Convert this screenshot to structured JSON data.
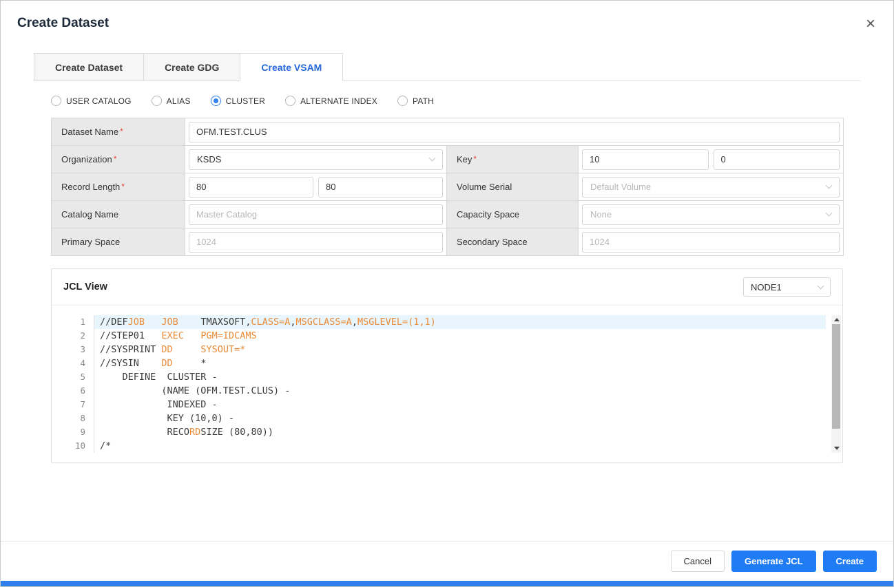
{
  "modal": {
    "title": "Create Dataset",
    "close_glyph": "×"
  },
  "colors": {
    "accent": "#2f80ed",
    "keyword": "#e98b39",
    "required": "#e5493a",
    "active_line": "#e9f5fc"
  },
  "tabs": [
    {
      "label": "Create Dataset",
      "active": false
    },
    {
      "label": "Create GDG",
      "active": false
    },
    {
      "label": "Create VSAM",
      "active": true
    }
  ],
  "radio_group": [
    {
      "label": "USER CATALOG",
      "selected": false
    },
    {
      "label": "ALIAS",
      "selected": false
    },
    {
      "label": "CLUSTER",
      "selected": true
    },
    {
      "label": "ALTERNATE INDEX",
      "selected": false
    },
    {
      "label": "PATH",
      "selected": false
    }
  ],
  "form": {
    "required_mark": "*",
    "dataset_name": {
      "label": "Dataset Name",
      "required": true,
      "value": "OFM.TEST.CLUS"
    },
    "organization": {
      "label": "Organization",
      "required": true,
      "value": "KSDS"
    },
    "key": {
      "label": "Key",
      "required": true,
      "value1": "10",
      "value2": "0"
    },
    "record_length": {
      "label": "Record Length",
      "required": true,
      "value1": "80",
      "value2": "80"
    },
    "volume_serial": {
      "label": "Volume Serial",
      "placeholder": "Default Volume"
    },
    "catalog_name": {
      "label": "Catalog Name",
      "placeholder": "Master Catalog"
    },
    "capacity_space": {
      "label": "Capacity Space",
      "placeholder": "None"
    },
    "primary_space": {
      "label": "Primary Space",
      "placeholder": "1024"
    },
    "secondary_space": {
      "label": "Secondary Space",
      "placeholder": "1024"
    }
  },
  "jcl_view": {
    "title": "JCL View",
    "node_select_value": "NODE1",
    "lines": [
      {
        "no": "1",
        "active": true,
        "segments": [
          {
            "t": "//DEF"
          },
          {
            "t": "JOB",
            "c": "k"
          },
          {
            "t": "   "
          },
          {
            "t": "JOB",
            "c": "k"
          },
          {
            "t": "    "
          },
          {
            "t": "TMAXSOFT,"
          },
          {
            "t": "CLASS=A",
            "c": "k"
          },
          {
            "t": ","
          },
          {
            "t": "MSGCLASS=A",
            "c": "k"
          },
          {
            "t": ","
          },
          {
            "t": "MSGLEVEL=(1,1)",
            "c": "k"
          }
        ]
      },
      {
        "no": "2",
        "active": false,
        "segments": [
          {
            "t": "//STEP01"
          },
          {
            "t": "   "
          },
          {
            "t": "EXEC",
            "c": "k"
          },
          {
            "t": "   "
          },
          {
            "t": "PGM=IDCAMS",
            "c": "k"
          }
        ]
      },
      {
        "no": "3",
        "active": false,
        "segments": [
          {
            "t": "//SYSPRINT"
          },
          {
            "t": " "
          },
          {
            "t": "DD",
            "c": "k"
          },
          {
            "t": "     "
          },
          {
            "t": "SYSOUT=*",
            "c": "k"
          }
        ]
      },
      {
        "no": "4",
        "active": false,
        "segments": [
          {
            "t": "//SYSIN"
          },
          {
            "t": "    "
          },
          {
            "t": "DD",
            "c": "k"
          },
          {
            "t": "     "
          },
          {
            "t": "*"
          }
        ]
      },
      {
        "no": "5",
        "active": false,
        "segments": [
          {
            "t": "    DEFINE  CLUSTER -"
          }
        ]
      },
      {
        "no": "6",
        "active": false,
        "segments": [
          {
            "t": "           (NAME (OFM.TEST.CLUS) -"
          }
        ]
      },
      {
        "no": "7",
        "active": false,
        "segments": [
          {
            "t": "            INDEXED -"
          }
        ]
      },
      {
        "no": "8",
        "active": false,
        "segments": [
          {
            "t": "            KEY (10,0) -"
          }
        ]
      },
      {
        "no": "9",
        "active": false,
        "segments": [
          {
            "t": "            RECO"
          },
          {
            "t": "RD",
            "c": "k"
          },
          {
            "t": "SIZE (80,80))"
          }
        ]
      },
      {
        "no": "10",
        "active": false,
        "segments": [
          {
            "t": "/*"
          }
        ]
      }
    ]
  },
  "footer": {
    "cancel_label": "Cancel",
    "generate_jcl_label": "Generate JCL",
    "create_label": "Create"
  }
}
